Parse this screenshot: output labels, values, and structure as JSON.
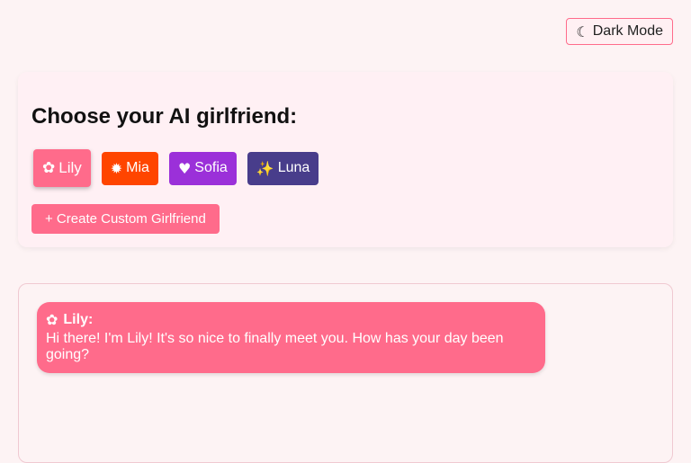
{
  "header": {
    "dark_mode_icon": "moon-icon",
    "dark_mode_glyph": "☾",
    "dark_mode_label": "Dark Mode"
  },
  "selector": {
    "title": "Choose your AI girlfriend:",
    "girlfriends": [
      {
        "label": "Lily",
        "icon": "flower-icon",
        "glyph": "✿",
        "color": "#ff6b8b",
        "active": true
      },
      {
        "label": "Mia",
        "icon": "fire-icon",
        "glyph": "✹",
        "color": "#ff4500",
        "active": false
      },
      {
        "label": "Sofia",
        "icon": "heart-icon",
        "glyph": "♥",
        "color": "#9b30d9",
        "active": false
      },
      {
        "label": "Luna",
        "icon": "sparkles-icon",
        "glyph": "✨",
        "color": "#483d8b",
        "active": false
      }
    ],
    "create_label": "+ Create Custom Girlfriend"
  },
  "chat": {
    "messages": [
      {
        "sender": "Lily:",
        "icon": "flower-icon",
        "glyph": "✿",
        "text": "Hi there! I'm Lily! It's so nice to finally meet you. How has your day been going?"
      }
    ]
  }
}
